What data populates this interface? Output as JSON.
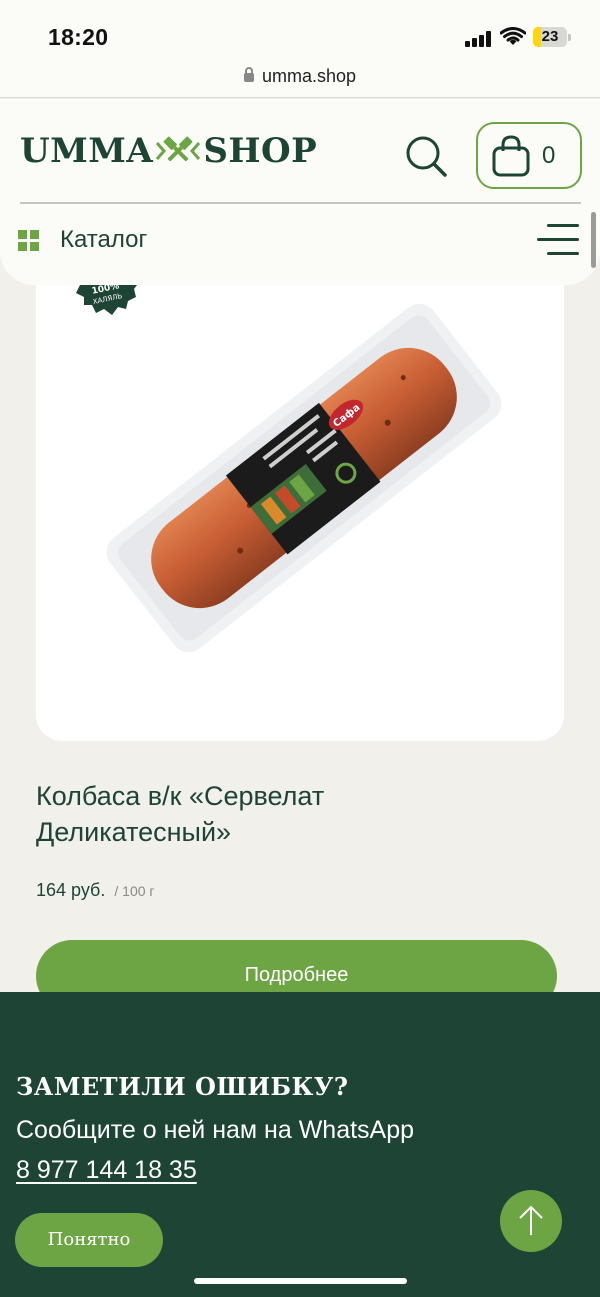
{
  "status_bar": {
    "time": "18:20",
    "battery_level": "23",
    "battery_fraction": 0.23,
    "icons": [
      "signal-icon",
      "wifi-icon",
      "battery-icon"
    ]
  },
  "browser": {
    "url": "umma.shop",
    "lock_icon": "lock-icon"
  },
  "header": {
    "logo_left": "UMMA",
    "logo_right": "SHOP",
    "cart_count": "0",
    "catalog_label": "Каталог",
    "icons": [
      "search-icon",
      "cart-icon",
      "grid-icon",
      "menu-icon"
    ]
  },
  "product": {
    "title": "Колбаса в/к «Сервелат Деликатесный»",
    "price": "164 руб.",
    "unit": "/ 100 г",
    "details_label": "Подробнее",
    "image_icon": "sausage-product-image",
    "badge_icon": "halal-badge-icon"
  },
  "notice": {
    "title": "ЗАМЕТИЛИ ОШИБКУ?",
    "text": "Сообщите о ней нам на WhatsApp",
    "phone": "8 977 144 18 35",
    "ok_label": "Понятно",
    "up_icon": "arrow-up-icon"
  },
  "colors": {
    "brand_dark": "#1e4436",
    "brand_green": "#6ea544",
    "background": "#f1f0ea"
  }
}
